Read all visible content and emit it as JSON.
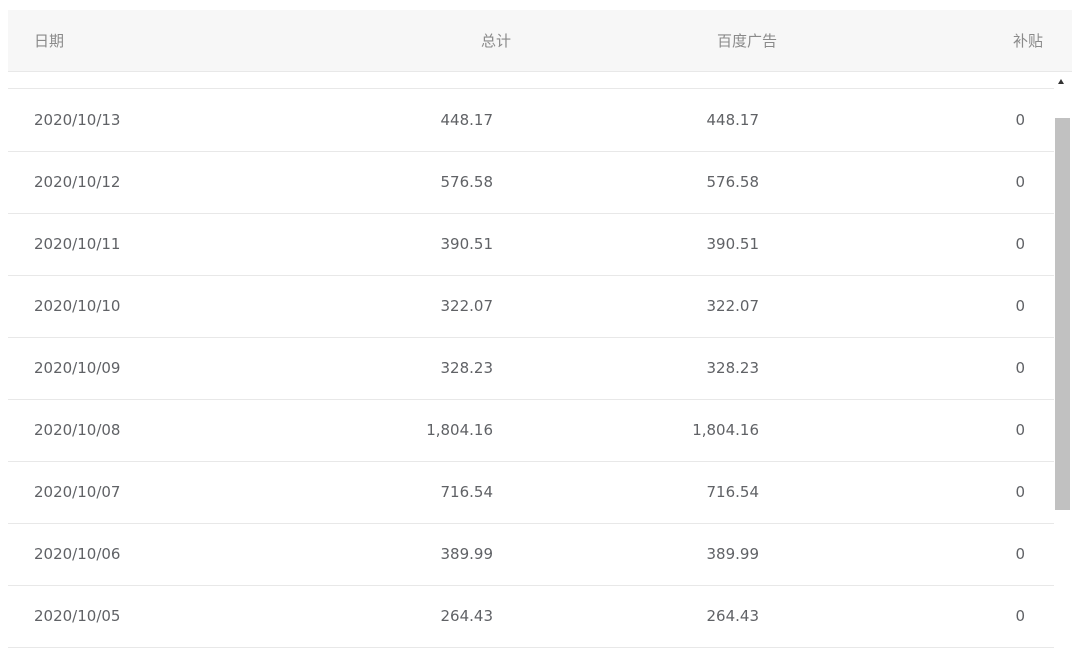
{
  "table": {
    "columns": [
      "日期",
      "总计",
      "百度广告",
      "补贴"
    ],
    "rows": [
      {
        "date": "2020/10/13",
        "total": "448.17",
        "baidu_ads": "448.17",
        "subsidy": "0"
      },
      {
        "date": "2020/10/12",
        "total": "576.58",
        "baidu_ads": "576.58",
        "subsidy": "0"
      },
      {
        "date": "2020/10/11",
        "total": "390.51",
        "baidu_ads": "390.51",
        "subsidy": "0"
      },
      {
        "date": "2020/10/10",
        "total": "322.07",
        "baidu_ads": "322.07",
        "subsidy": "0"
      },
      {
        "date": "2020/10/09",
        "total": "328.23",
        "baidu_ads": "328.23",
        "subsidy": "0"
      },
      {
        "date": "2020/10/08",
        "total": "1,804.16",
        "baidu_ads": "1,804.16",
        "subsidy": "0"
      },
      {
        "date": "2020/10/07",
        "total": "716.54",
        "baidu_ads": "716.54",
        "subsidy": "0"
      },
      {
        "date": "2020/10/06",
        "total": "389.99",
        "baidu_ads": "389.99",
        "subsidy": "0"
      },
      {
        "date": "2020/10/05",
        "total": "264.43",
        "baidu_ads": "264.43",
        "subsidy": "0"
      }
    ]
  },
  "scrollbar": {
    "up_icon": "triangle-up-icon"
  }
}
